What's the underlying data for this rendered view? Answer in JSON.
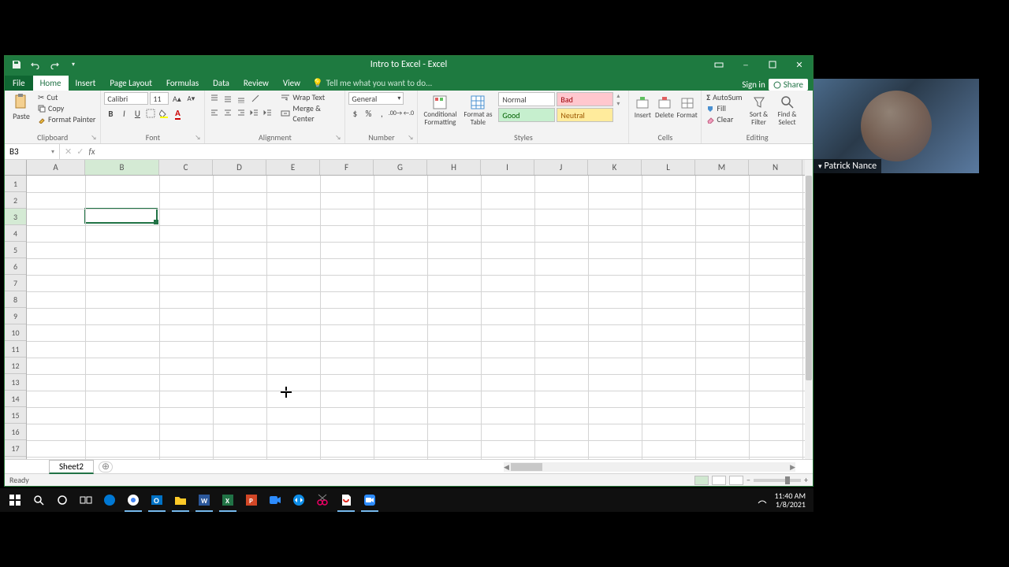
{
  "window": {
    "title": "Intro to Excel - Excel",
    "signin": "Sign in",
    "share": "Share"
  },
  "tabs": {
    "file": "File",
    "home": "Home",
    "insert": "Insert",
    "pagelayout": "Page Layout",
    "formulas": "Formulas",
    "data": "Data",
    "review": "Review",
    "view": "View",
    "tellme": "Tell me what you want to do..."
  },
  "ribbon": {
    "clipboard": {
      "label": "Clipboard",
      "paste": "Paste",
      "cut": "Cut",
      "copy": "Copy",
      "formatpainter": "Format Painter"
    },
    "font": {
      "label": "Font",
      "name": "Calibri",
      "size": "11"
    },
    "alignment": {
      "label": "Alignment",
      "wrap": "Wrap Text",
      "merge": "Merge & Center"
    },
    "number": {
      "label": "Number",
      "format": "General"
    },
    "styles": {
      "label": "Styles",
      "conditional": "Conditional Formatting",
      "formatas": "Format as Table",
      "normal": "Normal",
      "bad": "Bad",
      "good": "Good",
      "neutral": "Neutral"
    },
    "cells": {
      "label": "Cells",
      "insert": "Insert",
      "delete": "Delete",
      "format": "Format"
    },
    "editing": {
      "label": "Editing",
      "autosum": "AutoSum",
      "fill": "Fill",
      "clear": "Clear",
      "sort": "Sort & Filter",
      "find": "Find & Select"
    }
  },
  "namebox": "B3",
  "formula": "",
  "columns": [
    "A",
    "B",
    "C",
    "D",
    "E",
    "F",
    "G",
    "H",
    "I",
    "J",
    "K",
    "L",
    "M",
    "N"
  ],
  "rows": [
    "1",
    "2",
    "3",
    "4",
    "5",
    "6",
    "7",
    "8",
    "9",
    "10",
    "11",
    "12",
    "13",
    "14",
    "15",
    "16",
    "17"
  ],
  "active": {
    "col": "B",
    "row": "3"
  },
  "sheet": {
    "name": "Sheet2"
  },
  "status": {
    "ready": "Ready"
  },
  "webcam": {
    "name": "Patrick Nance"
  },
  "clock": {
    "time": "11:40 AM",
    "date": "1/8/2021"
  },
  "colors": {
    "excel_green": "#217346",
    "bad_bg": "#ffc7ce",
    "bad_fg": "#9c0006",
    "good_bg": "#c6efce",
    "good_fg": "#006100",
    "neutral_bg": "#ffeb9c",
    "neutral_fg": "#9c5700"
  }
}
